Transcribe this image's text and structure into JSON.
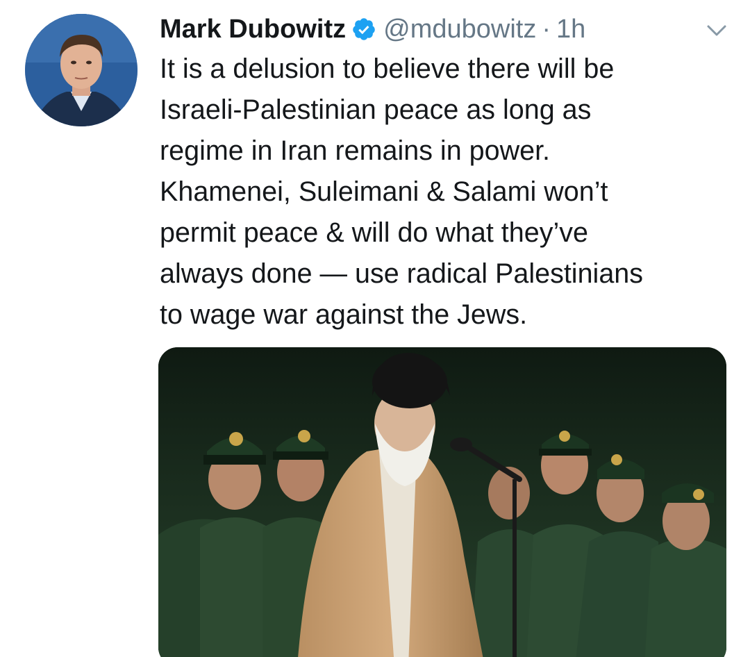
{
  "tweet": {
    "author_name": "Mark Dubowitz",
    "handle": "@mdubowitz",
    "separator": "·",
    "time": "1h",
    "verified": true,
    "text_lines": [
      "It is a delusion to believe there will be",
      "Israeli-Palestinian peace as long as",
      "regime in Iran remains in power.",
      "Khamenei, Suleimani & Salami won’t",
      "permit peace & will do what they’ve",
      "always done — use radical Palestinians",
      "to wage war against the Jews."
    ]
  },
  "icons": {
    "verified": "verified-badge-icon",
    "menu": "chevron-down-icon"
  },
  "colors": {
    "name": "#14171a",
    "secondary": "#657786",
    "verified_blue": "#1da1f2",
    "background": "#ffffff"
  }
}
